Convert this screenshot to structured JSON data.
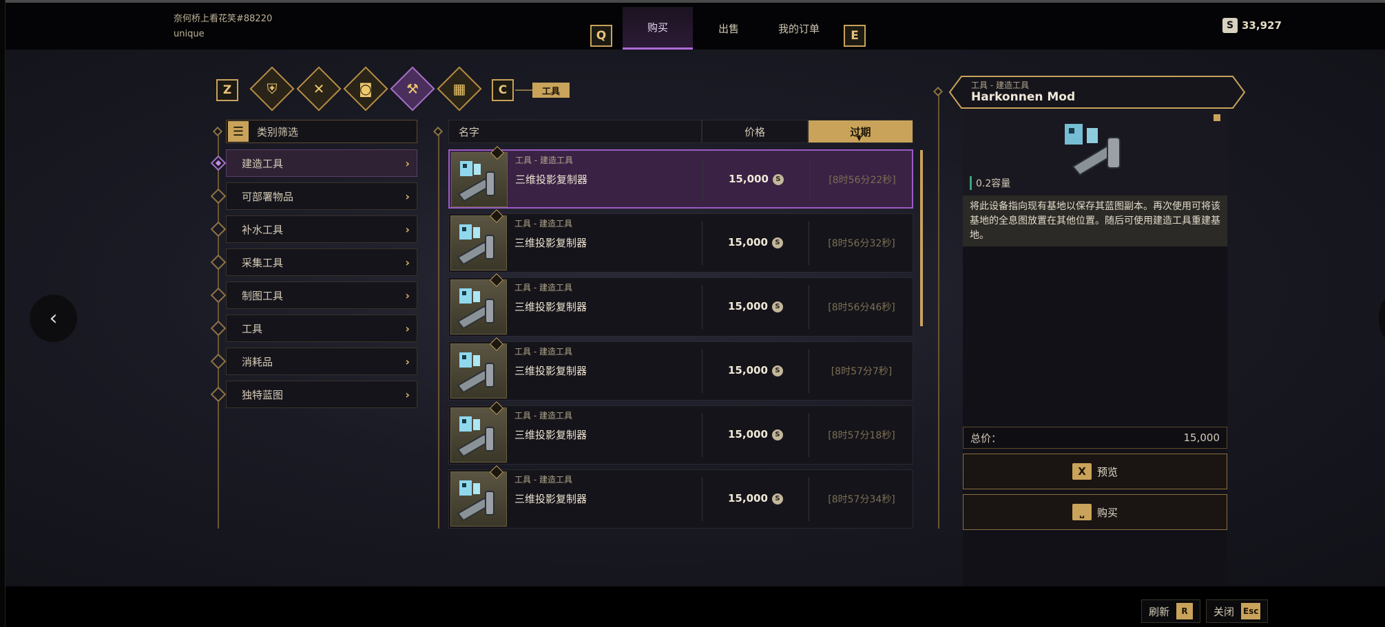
{
  "player": {
    "name": "奈何桥上看花笑#88220",
    "sub": "unique"
  },
  "top_keys": {
    "left": "Q",
    "right": "E"
  },
  "tabs": [
    {
      "label": "购买",
      "active": true
    },
    {
      "label": "出售",
      "active": false
    },
    {
      "label": "我的订单",
      "active": false
    }
  ],
  "currency": {
    "symbol": "S",
    "amount": "33,927"
  },
  "category_bar": {
    "left_key": "Z",
    "right_key": "C",
    "selected_label": "工具",
    "icons": [
      "armor-icon",
      "weapons-icon",
      "utility-icon",
      "hammer-icon",
      "components-icon"
    ]
  },
  "filter": {
    "header": "类别筛选"
  },
  "sidebar": {
    "items": [
      {
        "label": "建造工具",
        "active": true
      },
      {
        "label": "可部署物品",
        "active": false
      },
      {
        "label": "补水工具",
        "active": false
      },
      {
        "label": "采集工具",
        "active": false
      },
      {
        "label": "制图工具",
        "active": false
      },
      {
        "label": "工具",
        "active": false
      },
      {
        "label": "消耗品",
        "active": false
      },
      {
        "label": "独特蓝图",
        "active": false
      }
    ]
  },
  "table": {
    "headers": {
      "name": "名字",
      "price": "价格",
      "expiry": "过期"
    },
    "rows": [
      {
        "category": "工具 - 建造工具",
        "name": "三维投影复制器",
        "price": "15,000",
        "expiry": "[8时56分22秒]"
      },
      {
        "category": "工具 - 建造工具",
        "name": "三维投影复制器",
        "price": "15,000",
        "expiry": "[8时56分32秒]"
      },
      {
        "category": "工具 - 建造工具",
        "name": "三维投影复制器",
        "price": "15,000",
        "expiry": "[8时56分46秒]"
      },
      {
        "category": "工具 - 建造工具",
        "name": "三维投影复制器",
        "price": "15,000",
        "expiry": "[8时57分7秒]"
      },
      {
        "category": "工具 - 建造工具",
        "name": "三维投影复制器",
        "price": "15,000",
        "expiry": "[8时57分18秒]"
      },
      {
        "category": "工具 - 建造工具",
        "name": "三维投影复制器",
        "price": "15,000",
        "expiry": "[8时57分34秒]"
      }
    ]
  },
  "detail": {
    "category": "工具 - 建造工具",
    "name": "Harkonnen Mod",
    "capacity": "0.2容量",
    "description": "将此设备指向现有基地以保存其蓝图副本。再次使用可将该基地的全息图放置在其他位置。随后可使用建造工具重建基地。",
    "total_label": "总价：",
    "total_value": "15,000",
    "preview_key": "X",
    "preview_label": "预览",
    "buy_label": "购买"
  },
  "footer": {
    "refresh_label": "刷新",
    "refresh_key": "R",
    "close_label": "关闭",
    "close_key": "Esc"
  },
  "colors": {
    "accent_gold": "#c9a35a",
    "accent_purple": "#a571c8",
    "background": "#1a1a24"
  }
}
